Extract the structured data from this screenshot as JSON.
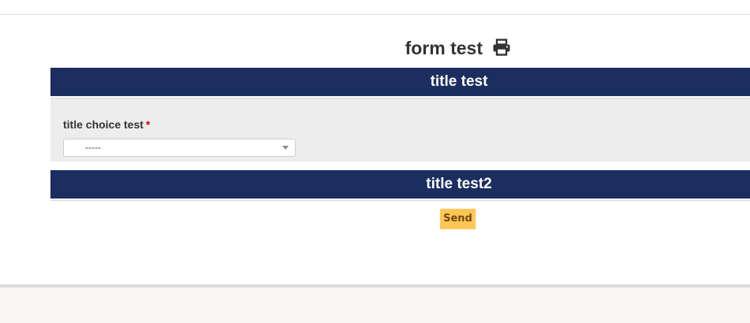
{
  "form": {
    "title": "form test",
    "print_icon": "print-icon"
  },
  "sections": [
    {
      "title": "title test",
      "fields": [
        {
          "label": "title choice test",
          "required_mark": "*",
          "selected_value": "-----"
        }
      ]
    },
    {
      "title": "title test2"
    }
  ],
  "actions": {
    "send_label": "Send"
  },
  "colors": {
    "section_header": "#1c2e60",
    "section_body": "#ededed",
    "send_button": "#ffc655",
    "required": "#d0021b"
  }
}
